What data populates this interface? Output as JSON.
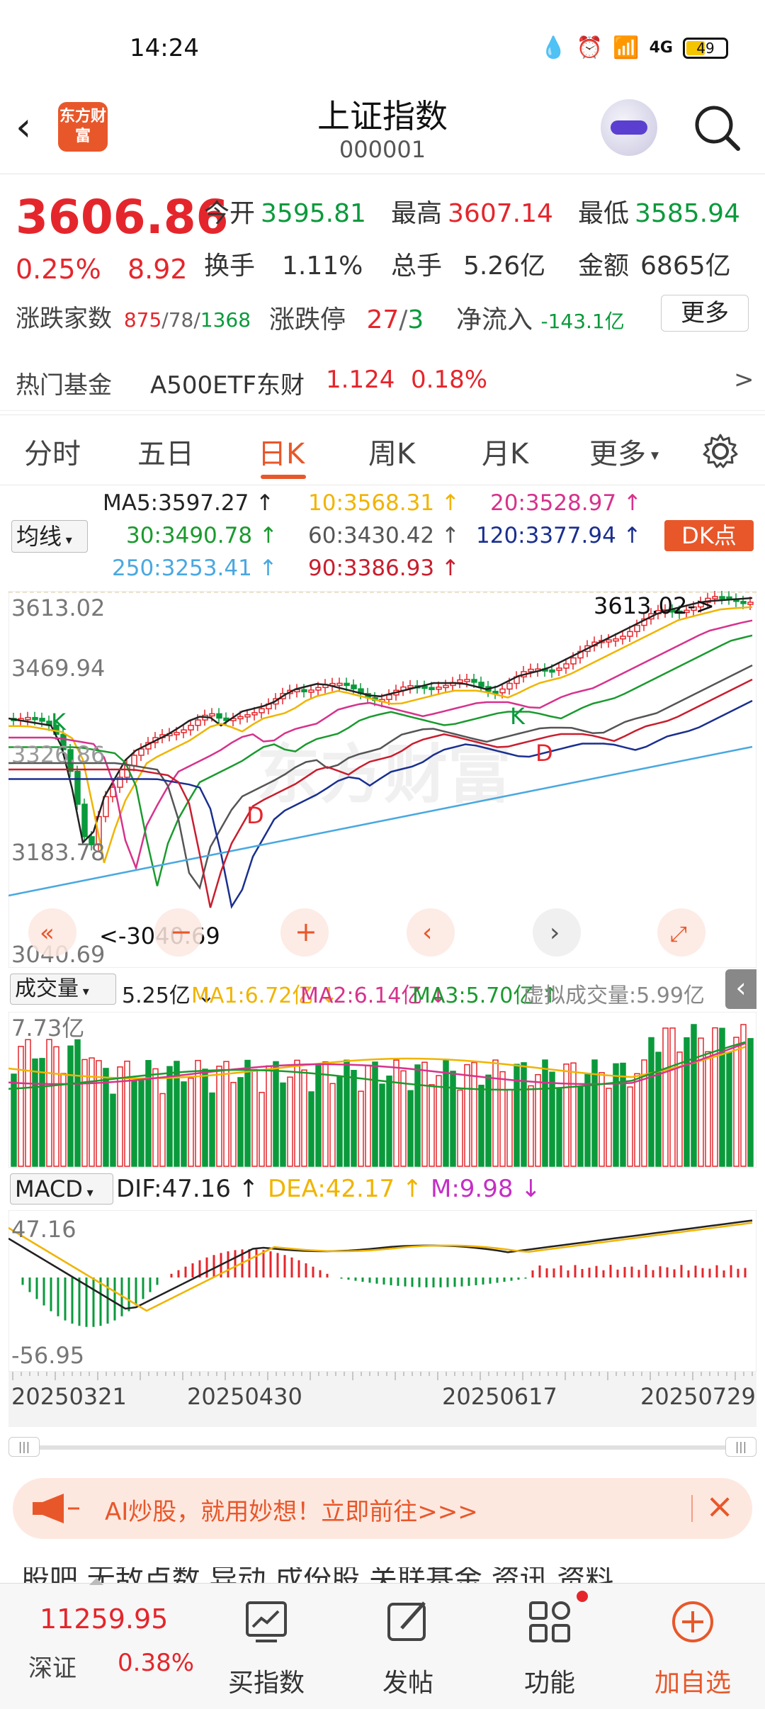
{
  "status_bar": {
    "time": "14:24",
    "battery": "49",
    "network": "4G"
  },
  "header": {
    "title": "上证指数",
    "code": "000001",
    "logo_text": "东方财富"
  },
  "quote": {
    "price": "3606.86",
    "change_pct": "0.25%",
    "change": "8.92",
    "open_label": "今开",
    "open": "3595.81",
    "high_label": "最高",
    "high": "3607.14",
    "low_label": "最低",
    "low": "3585.94",
    "turnover_label": "换手",
    "turnover": "1.11%",
    "volume_label": "总手",
    "volume": "5.26亿",
    "amount_label": "金额",
    "amount": "6865亿",
    "breadth_label": "涨跌家数",
    "breadth_up": "875",
    "breadth_flat": "78",
    "breadth_down": "1368",
    "limit_label": "涨跌停",
    "limit_up": "27",
    "limit_down": "3",
    "netflow_label": "净流入",
    "netflow": "-143.1亿",
    "more_label": "更多"
  },
  "hot_fund": {
    "label": "热门基金",
    "name": "A500ETF东财",
    "price": "1.124",
    "pct": "0.18%",
    "arrow": ">"
  },
  "tabs": [
    {
      "label": "分时"
    },
    {
      "label": "五日"
    },
    {
      "label": "日K"
    },
    {
      "label": "周K"
    },
    {
      "label": "月K"
    },
    {
      "label": "更多"
    }
  ],
  "ma_legend": {
    "select": "均线",
    "items": [
      {
        "text": "MA5:3597.27 ↑",
        "color": "#222222"
      },
      {
        "text": "10:3568.31 ↑",
        "color": "#f0b400"
      },
      {
        "text": "20:3528.97 ↑",
        "color": "#d6338c"
      },
      {
        "text": "30:3490.78 ↑",
        "color": "#1a9a2e"
      },
      {
        "text": "60:3430.42 ↑",
        "color": "#555555"
      },
      {
        "text": "120:3377.94 ↑",
        "color": "#1a2f8f"
      },
      {
        "text": "250:3253.41 ↑",
        "color": "#4aa8e0"
      },
      {
        "text": "90:3386.93 ↑",
        "color": "#c81e2e"
      }
    ],
    "dk_button": "DK点"
  },
  "kline": {
    "y_labels": [
      "3613.02",
      "3469.94",
      "3326.86",
      "3183.78",
      "3040.69"
    ],
    "max_note": "3613.02->",
    "min_note": "<-3040.69",
    "markers": [
      "K",
      "K",
      "D",
      "D"
    ],
    "watermark": "东方财富"
  },
  "volume": {
    "select": "成交量",
    "value": "5.25亿 ↓",
    "ma1": "MA1:6.72亿 ↓",
    "ma2": "MA2:6.14亿 ↓",
    "ma3": "MA3:5.70亿 ↑",
    "virtual": "虚拟成交量:5.99亿",
    "y_top": "7.73亿"
  },
  "macd": {
    "select": "MACD",
    "dif": "DIF:47.16 ↑",
    "dea": "DEA:42.17 ↑",
    "m": "M:9.98 ↓",
    "y_top": "47.16",
    "y_bottom": "-56.95"
  },
  "x_axis": [
    "20250321",
    "20250430",
    "20250617",
    "20250729"
  ],
  "banner": {
    "text": "AI炒股，就用妙想！立即前往>>>"
  },
  "bottom_tabs_partial": "股吧  无敌点数  异动  成份股  关联基金  资讯  资料",
  "bottom_bar": {
    "index_value": "11259.95",
    "index_name": "深证",
    "index_pct": "0.38%",
    "items": [
      {
        "label": "买指数"
      },
      {
        "label": "发帖"
      },
      {
        "label": "功能"
      },
      {
        "label": "加自选"
      }
    ]
  },
  "colors": {
    "up": "#e4262c",
    "down": "#0a9a3c",
    "accent": "#e8572a"
  }
}
